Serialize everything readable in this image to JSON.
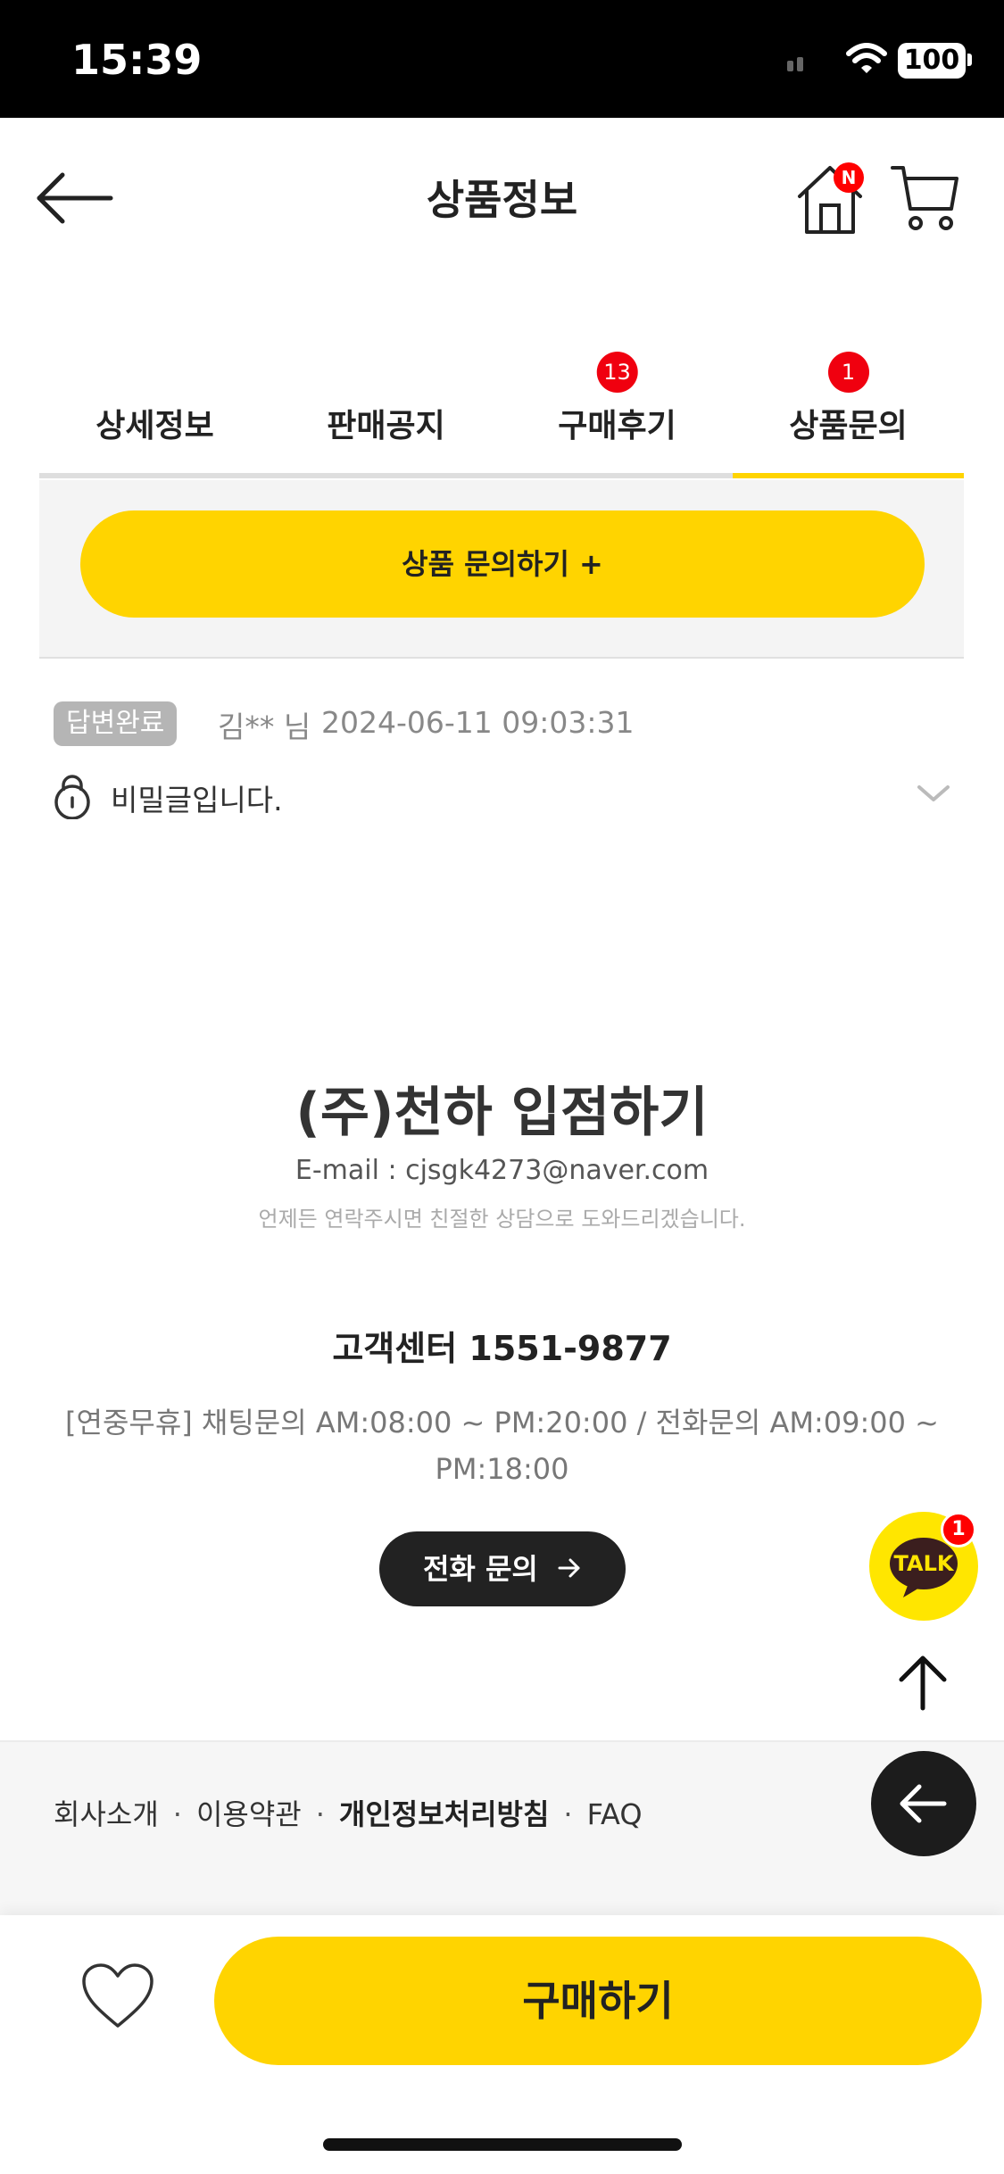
{
  "status_bar": {
    "time": "15:39",
    "battery": "100",
    "icons": [
      "signal-icon",
      "wifi-icon",
      "battery-icon"
    ]
  },
  "header": {
    "title": "상품정보",
    "home_badge": "N",
    "icons": [
      "back-arrow-icon",
      "home-icon",
      "cart-icon"
    ]
  },
  "tabs": [
    {
      "label": "상세정보",
      "badge": "",
      "active": false
    },
    {
      "label": "판매공지",
      "badge": "",
      "active": false
    },
    {
      "label": "구매후기",
      "badge": "13",
      "active": false
    },
    {
      "label": "상품문의",
      "badge": "1",
      "active": true
    }
  ],
  "inquiry": {
    "button_label": "상품 문의하기 +"
  },
  "qa_items": [
    {
      "status": "답변완료",
      "author": "김** 님",
      "date": "2024-06-11 09:03:31",
      "content": "비밀글입니다."
    }
  ],
  "promo": {
    "title": "(주)천하 입점하기",
    "email": "E-mail : cjsgk4273@naver.com",
    "subtitle": "언제든 연락주시면 친절한 상담으로 도와드리겠습니다."
  },
  "customer_center": {
    "title": "고객센터 1551-9877",
    "hours": "[연중무휴] 채팅문의 AM:08:00 ~ PM:20:00 / 전화문의 AM:09:00 ~ PM:18:00",
    "call_button": "전화 문의"
  },
  "floating": {
    "talk_label": "TALK",
    "talk_badge": "1"
  },
  "footer": {
    "links": [
      "회사소개",
      "이용약관",
      "개인정보처리방침",
      "FAQ"
    ],
    "separator": "·"
  },
  "bottom_bar": {
    "buy_label": "구매하기"
  },
  "colors": {
    "accent_yellow": "#ffd400",
    "badge_red": "#f0000f",
    "dark": "#222222"
  }
}
